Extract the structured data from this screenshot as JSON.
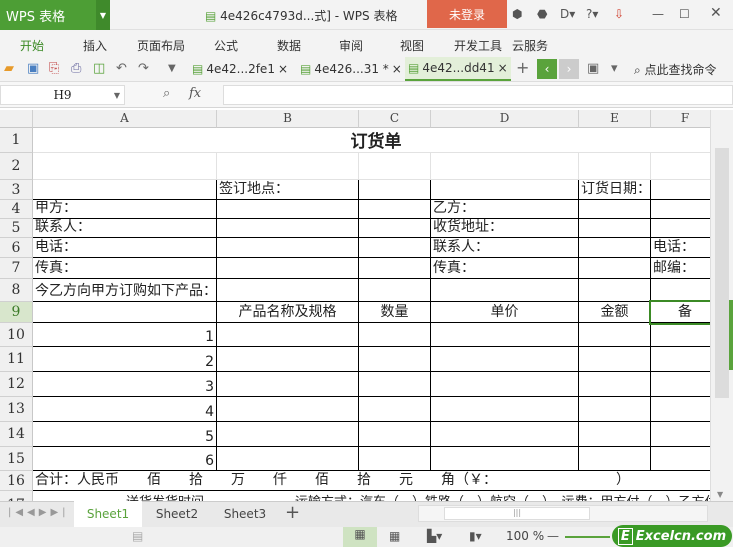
{
  "app": {
    "logo": "WPS 表格",
    "title": "4e426c4793d...式] - WPS 表格",
    "login": "未登录"
  },
  "menu": [
    "开始",
    "插入",
    "页面布局",
    "公式",
    "数据",
    "审阅",
    "视图",
    "开发工具",
    "云服务"
  ],
  "doc_tabs": [
    "4e42...2fe1",
    "4e426...31 *",
    "4e42...dd41"
  ],
  "search_cmd": "点此查找命令",
  "namebox": "H9",
  "fx": "fx",
  "columns": [
    "A",
    "B",
    "C",
    "D",
    "E",
    "F"
  ],
  "rows": [
    "1",
    "2",
    "3",
    "4",
    "5",
    "6",
    "7",
    "8",
    "9",
    "10",
    "11",
    "12",
    "13",
    "14",
    "15",
    "16",
    "17"
  ],
  "cells": {
    "title": "订货单",
    "r3b": "签订地点：",
    "r3e": "订货日期：",
    "r4a": "甲方：",
    "r4d": "乙方：",
    "r5a": "联系人：",
    "r5d": "收货地址：",
    "r6a": "电话：",
    "r6d": "联系人：",
    "r6f": "电话：",
    "r7a": "传真：",
    "r7d": "传真：",
    "r7f": "邮编：",
    "r8a": "今乙方向甲方订购如下产品：",
    "r9b": "产品名称及规格",
    "r9c": "数量",
    "r9d": "单价",
    "r9e": "金额",
    "r9f": "备",
    "nums": [
      "1",
      "2",
      "3",
      "4",
      "5",
      "6"
    ],
    "r16": "合计：人民币　　佰　　拾　　万　　仟　　佰　　拾　　元　　角（￥：　　　　　　　　　）",
    "r17": "　　　　　　　送货发货时间　　　　　　　运输方式：汽车（　）铁路（　）航空（　）　运费：甲方付（　）乙方付（　）"
  },
  "sheets": [
    "Sheet1",
    "Sheet2",
    "Sheet3"
  ],
  "status": {
    "zoom": "100 %",
    "watermark": "Excelcn.com"
  }
}
